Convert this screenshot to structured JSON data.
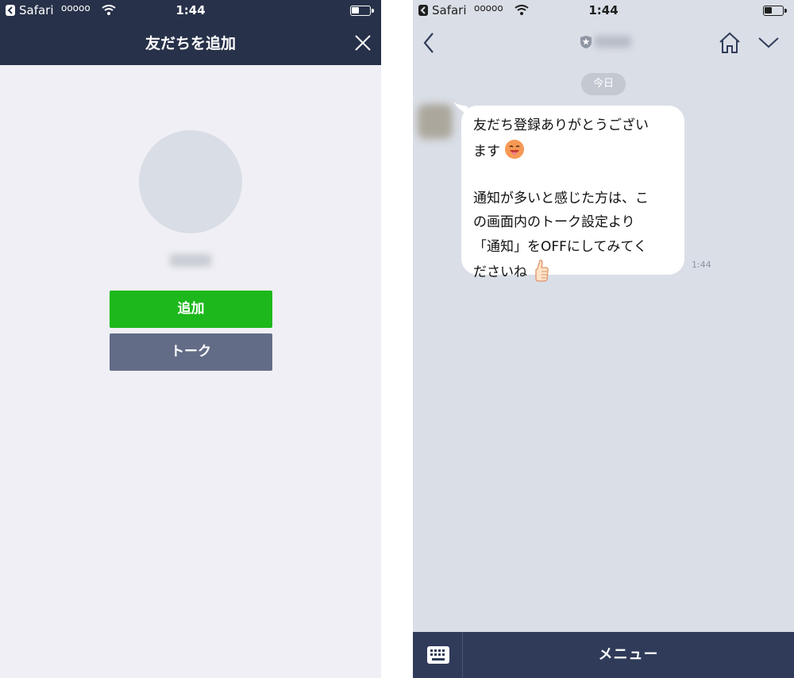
{
  "status_bar": {
    "carrier": "Safari",
    "signal_dots": "ooooo",
    "time": "1:44",
    "battery_level": 0.4
  },
  "left_screen": {
    "header_title": "友だちを追加",
    "add_button_label": "追加",
    "talk_button_label": "トーク"
  },
  "right_screen": {
    "date_label": "今日",
    "message": {
      "lines": [
        "友だち登録ありがとうござい",
        "ます",
        "",
        "通知が多いと感じた方は、こ",
        "の画面内のトーク設定より",
        "「通知」をOFFにしてみてく",
        "ださいね"
      ],
      "time": "1:44"
    },
    "menu_label": "メニュー"
  },
  "icons": {
    "close": "close-icon",
    "back": "chevron-left-icon",
    "home": "home-icon",
    "down": "chevron-down-icon",
    "keyboard": "keyboard-icon",
    "shield": "shield-star-icon",
    "wifi": "wifi-icon",
    "battery": "battery-icon"
  },
  "colors": {
    "left_header": "#273149",
    "add_green": "#1db81c",
    "talk_gray": "#636c87",
    "chat_bg": "#dadee6",
    "bottom_bar": "#2f3b59"
  }
}
